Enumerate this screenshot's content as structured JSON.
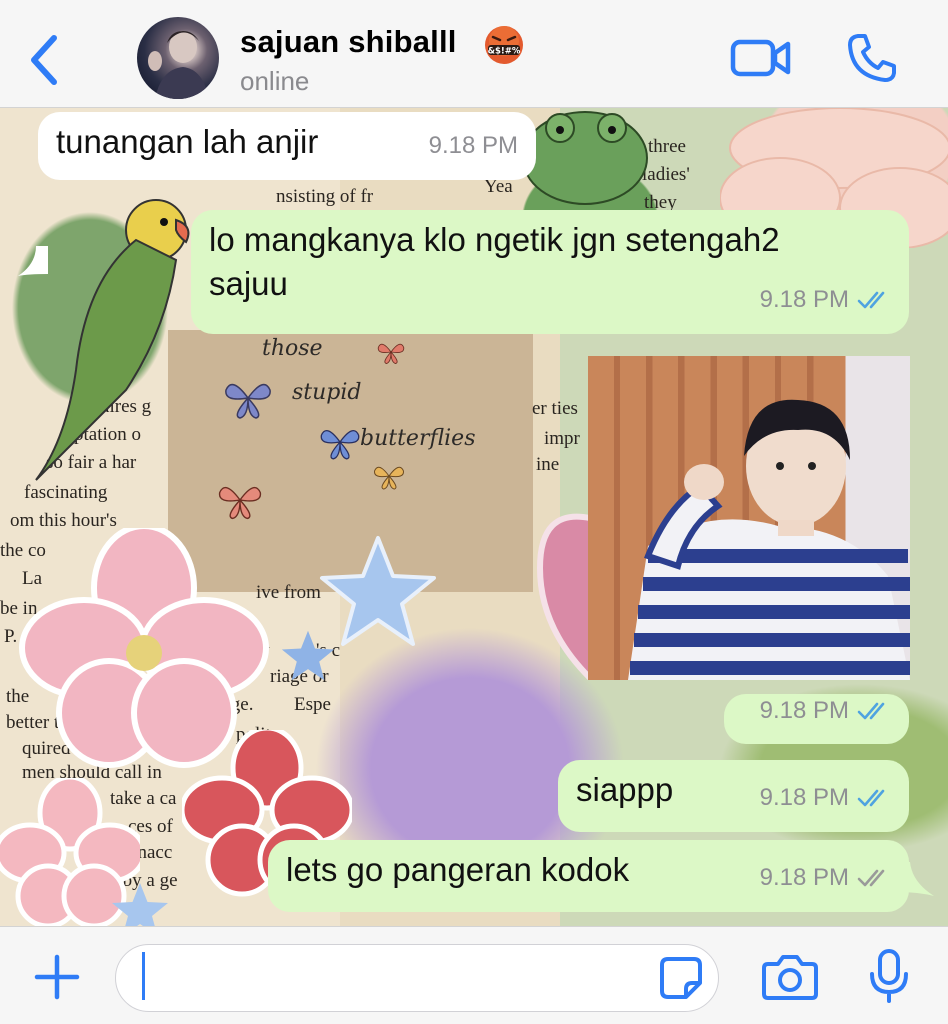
{
  "header": {
    "contact_name": "sajuan shiballl",
    "emoji_text": "&$!#%",
    "status": "online"
  },
  "wallpaper": {
    "note_lines": [
      "those",
      "stupid",
      "butterflies"
    ],
    "book_lines": [
      "three",
      "ladies'",
      "they",
      "nsisting of fr",
      "Yea",
      "uires g",
      "ptation o",
      "so fair a har",
      "fascinating",
      "om this hour's",
      "the co",
      "ive from",
      "be in",
      "w",
      "'s c",
      "riage or",
      "the",
      "better to",
      "arriage.",
      "Espe",
      "quired in",
      "polite",
      "men should call in",
      "take a ca",
      "ces of",
      "unacc",
      "ed by a ge",
      "er ties",
      "impr",
      "ine",
      "La",
      "P."
    ]
  },
  "messages": [
    {
      "direction": "incoming",
      "text": "tunangan lah anjir",
      "time": "9.18 PM"
    },
    {
      "direction": "outgoing",
      "text_line1": "lo mangkanya klo ngetik jgn setengah2",
      "text_line2": "sajuu",
      "time": "9.18 PM",
      "read": true
    },
    {
      "direction": "outgoing",
      "type": "image",
      "time": "9.18 PM",
      "read": true
    },
    {
      "direction": "outgoing",
      "text": "siappp",
      "time": "9.18 PM",
      "read": true
    },
    {
      "direction": "outgoing",
      "text": "lets go pangeran kodok",
      "time": "9.18 PM",
      "read": false
    }
  ],
  "icons": {
    "back": "chevron-left-icon",
    "video": "video-camera-icon",
    "call": "phone-icon",
    "plus": "plus-icon",
    "sticker": "sticker-icon",
    "camera": "camera-icon",
    "mic": "microphone-icon"
  },
  "colors": {
    "accent": "#2f7cf6",
    "outgoing_bubble": "#dcf8c6",
    "incoming_bubble": "#ffffff",
    "read_tick": "#4fa3e0",
    "unread_tick": "#9a9a9a"
  }
}
